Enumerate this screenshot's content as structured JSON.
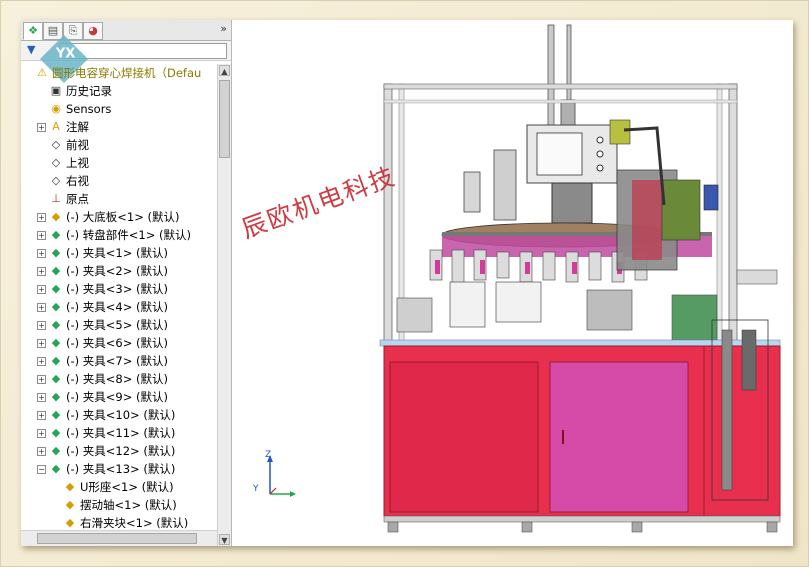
{
  "panel": {
    "tabs": [
      {
        "name": "feature-manager-tab",
        "glyph": "❖"
      },
      {
        "name": "property-manager-tab",
        "glyph": "▤"
      },
      {
        "name": "configuration-manager-tab",
        "glyph": "⎘"
      },
      {
        "name": "display-manager-tab",
        "glyph": "◕"
      }
    ],
    "more": "»",
    "filter_glyph": "▼"
  },
  "tree": [
    {
      "label": "圆形电容穿心焊接机（Defau",
      "expander": "",
      "indent": 0,
      "icon": "⚠",
      "iconColor": "#d4a000",
      "root": true
    },
    {
      "label": "历史记录",
      "expander": "",
      "indent": 1,
      "icon": "▣",
      "iconColor": "#333333"
    },
    {
      "label": "Sensors",
      "expander": "",
      "indent": 1,
      "icon": "◉",
      "iconColor": "#d4a000"
    },
    {
      "label": "注解",
      "expander": "+",
      "indent": 1,
      "icon": "A",
      "iconColor": "#d4a000"
    },
    {
      "label": "前视",
      "expander": "",
      "indent": 1,
      "icon": "◇",
      "iconColor": "#333333"
    },
    {
      "label": "上视",
      "expander": "",
      "indent": 1,
      "icon": "◇",
      "iconColor": "#333333"
    },
    {
      "label": "右视",
      "expander": "",
      "indent": 1,
      "icon": "◇",
      "iconColor": "#333333"
    },
    {
      "label": "原点",
      "expander": "",
      "indent": 1,
      "icon": "⊥",
      "iconColor": "#b03030"
    },
    {
      "label": "(-) 大底板<1> (默认)",
      "expander": "+",
      "indent": 1,
      "icon": "◆",
      "iconColor": "#d4a000"
    },
    {
      "label": "(-) 转盘部件<1> (默认)",
      "expander": "+",
      "indent": 1,
      "icon": "◆",
      "iconColor": "#2aa35a"
    },
    {
      "label": "(-) 夹具<1> (默认)",
      "expander": "+",
      "indent": 1,
      "icon": "◆",
      "iconColor": "#2aa35a"
    },
    {
      "label": "(-) 夹具<2> (默认)",
      "expander": "+",
      "indent": 1,
      "icon": "◆",
      "iconColor": "#2aa35a"
    },
    {
      "label": "(-) 夹具<3> (默认)",
      "expander": "+",
      "indent": 1,
      "icon": "◆",
      "iconColor": "#2aa35a"
    },
    {
      "label": "(-) 夹具<4> (默认)",
      "expander": "+",
      "indent": 1,
      "icon": "◆",
      "iconColor": "#2aa35a"
    },
    {
      "label": "(-) 夹具<5> (默认)",
      "expander": "+",
      "indent": 1,
      "icon": "◆",
      "iconColor": "#2aa35a"
    },
    {
      "label": "(-) 夹具<6> (默认)",
      "expander": "+",
      "indent": 1,
      "icon": "◆",
      "iconColor": "#2aa35a"
    },
    {
      "label": "(-) 夹具<7> (默认)",
      "expander": "+",
      "indent": 1,
      "icon": "◆",
      "iconColor": "#2aa35a"
    },
    {
      "label": "(-) 夹具<8> (默认)",
      "expander": "+",
      "indent": 1,
      "icon": "◆",
      "iconColor": "#2aa35a"
    },
    {
      "label": "(-) 夹具<9> (默认)",
      "expander": "+",
      "indent": 1,
      "icon": "◆",
      "iconColor": "#2aa35a"
    },
    {
      "label": "(-) 夹具<10> (默认)",
      "expander": "+",
      "indent": 1,
      "icon": "◆",
      "iconColor": "#2aa35a"
    },
    {
      "label": "(-) 夹具<11> (默认)",
      "expander": "+",
      "indent": 1,
      "icon": "◆",
      "iconColor": "#2aa35a"
    },
    {
      "label": "(-) 夹具<12> (默认)",
      "expander": "+",
      "indent": 1,
      "icon": "◆",
      "iconColor": "#2aa35a"
    },
    {
      "label": "(-) 夹具<13> (默认)",
      "expander": "−",
      "indent": 1,
      "icon": "◆",
      "iconColor": "#2aa35a"
    },
    {
      "label": "U形座<1> (默认)",
      "expander": "",
      "indent": 2,
      "icon": "◆",
      "iconColor": "#d4a000"
    },
    {
      "label": "摆动轴<1> (默认)",
      "expander": "",
      "indent": 2,
      "icon": "◆",
      "iconColor": "#d4a000"
    },
    {
      "label": "右滑夹块<1> (默认)",
      "expander": "",
      "indent": 2,
      "icon": "◆",
      "iconColor": "#d4a000"
    }
  ],
  "watermark": "辰欧机电科技",
  "triad": {
    "z": "Z",
    "y": "Y"
  },
  "logo_text": "YX"
}
